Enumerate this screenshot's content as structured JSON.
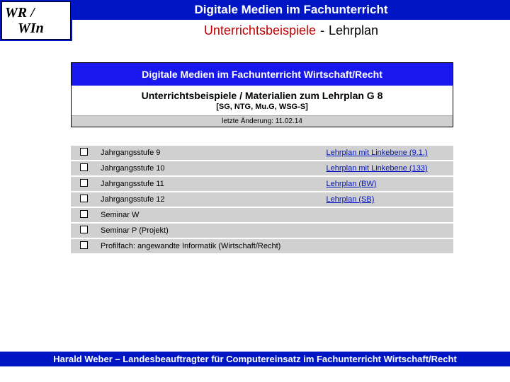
{
  "logo": {
    "line1": "WR /",
    "line2": "WIn"
  },
  "header": {
    "title": "Digitale Medien im Fachunterricht",
    "subtitle_red": "Unterrichtsbeispiele",
    "subtitle_sep": " - ",
    "subtitle_black": "Lehrplan"
  },
  "panel": {
    "title": "Digitale Medien im Fachunterricht Wirtschaft/Recht",
    "subheading": "Unterrichtsbeispiele / Materialien zum Lehrplan G 8",
    "subheading2": "[SG, NTG, Mu.G, WSG-S]",
    "meta": "letzte Änderung: 11.02.14"
  },
  "rows": [
    {
      "label": "Jahrgangsstufe 9",
      "link": "Lehrplan mit Linkebene (9.1.)"
    },
    {
      "label": "Jahrgangsstufe 10",
      "link": "Lehrplan mit Linkebene (133)"
    },
    {
      "label": "Jahrgangsstufe 11",
      "link": "Lehrplan (BW)"
    },
    {
      "label": "Jahrgangsstufe 12",
      "link": "Lehrplan (SB)"
    },
    {
      "label": "Seminar W",
      "link": ""
    },
    {
      "label": "Seminar P (Projekt)",
      "link": ""
    },
    {
      "label": "Profilfach: angewandte Informatik (Wirtschaft/Recht)",
      "link": ""
    }
  ],
  "footer": "Harald Weber – Landesbeauftragter für Computereinsatz im Fachunterricht Wirtschaft/Recht"
}
